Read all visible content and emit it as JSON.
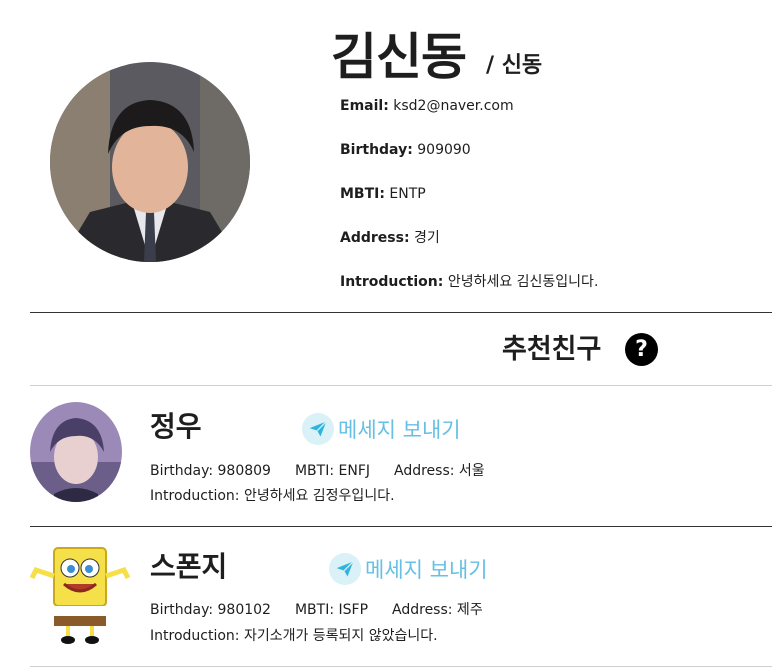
{
  "profile": {
    "name": "김신동",
    "nickname": "/ 신동",
    "fields": [
      {
        "label": "Email:",
        "value": "ksd2@naver.com"
      },
      {
        "label": "Birthday:",
        "value": "909090"
      },
      {
        "label": "MBTI:",
        "value": "ENTP"
      },
      {
        "label": "Address:",
        "value": "경기"
      },
      {
        "label": "Introduction:",
        "value": "안녕하세요 김신동입니다."
      }
    ]
  },
  "recommend": {
    "title": "추천친구",
    "help_icon": "?"
  },
  "friends": [
    {
      "name": "정우",
      "message_label": "메세지 보내기",
      "birthday": "Birthday: 980809",
      "mbti": "MBTI: ENFJ",
      "address": "Address: 서울",
      "intro": "Introduction: 안녕하세요 김정우입니다."
    },
    {
      "name": "스폰지",
      "message_label": "메세지 보내기",
      "birthday": "Birthday: 980102",
      "mbti": "MBTI: ISFP",
      "address": "Address: 제주",
      "intro": "Introduction: 자기소개가 등록되지 않았습니다."
    }
  ],
  "colors": {
    "accent": "#66c0e4",
    "accent_bg": "#d9f1f7",
    "text": "#1e1e1e"
  },
  "icons": {
    "help": "question-circle-icon",
    "send": "paper-plane-icon"
  }
}
